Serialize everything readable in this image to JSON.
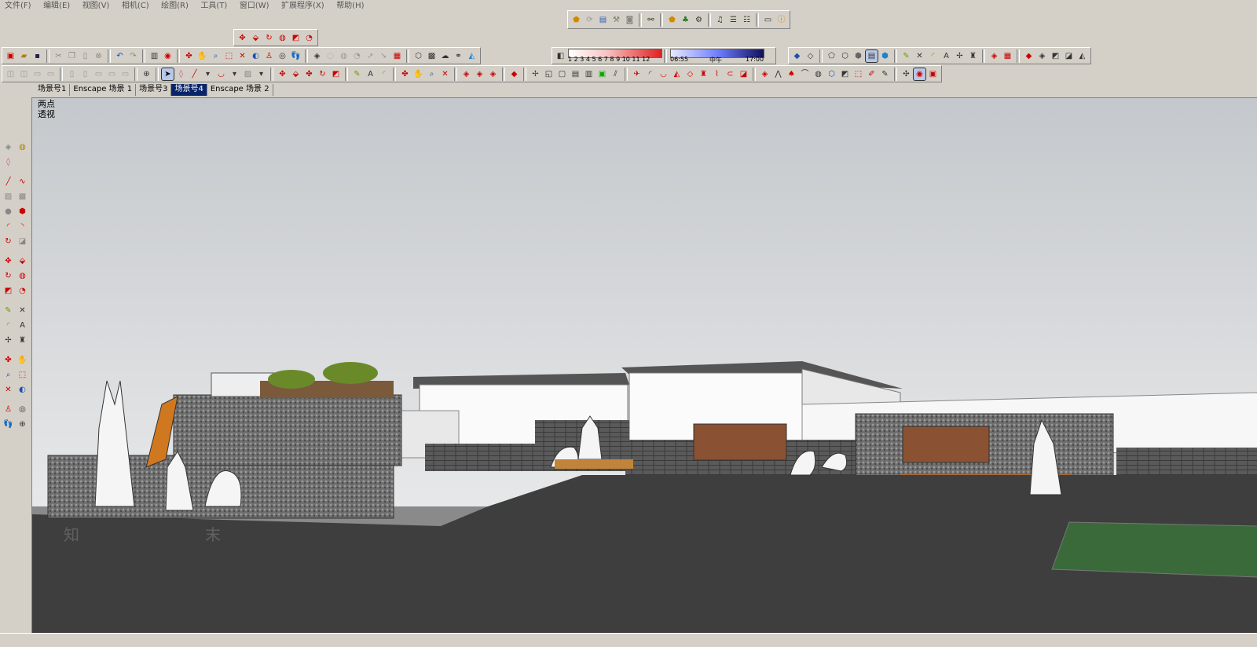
{
  "menu": [
    "文件(F)",
    "编辑(E)",
    "视图(V)",
    "相机(C)",
    "绘图(R)",
    "工具(T)",
    "窗口(W)",
    "扩展程序(X)",
    "帮助(H)"
  ],
  "camera": {
    "line1": "两点",
    "line2": "透视"
  },
  "scene_tabs": [
    {
      "label": "场景号1",
      "selected": false
    },
    {
      "label": "Enscape 场景 1",
      "selected": false
    },
    {
      "label": "场景号3",
      "selected": false
    },
    {
      "label": "场景号4",
      "selected": true
    },
    {
      "label": "Enscape 场景 2",
      "selected": false
    }
  ],
  "shadow": {
    "months": "1 2 3 4 5 6 7 8 9 10 11 12",
    "time_start": "06:55",
    "time_mid": "中午",
    "time_end": "17:00"
  },
  "watermark": "知末",
  "colors": {
    "accent": "#0a246a",
    "sky_top": "#c7ccd1",
    "ground": "#3a3a3a"
  }
}
